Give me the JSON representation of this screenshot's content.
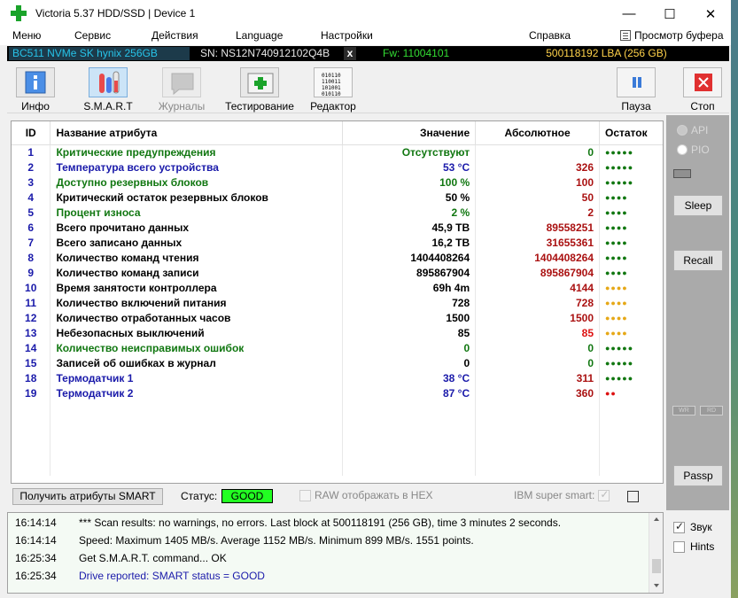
{
  "window": {
    "title": "Victoria 5.37 HDD/SSD | Device 1",
    "minimize": "—",
    "maximize": "☐",
    "close": "✕"
  },
  "menu": {
    "items": [
      "Меню",
      "Сервис",
      "Действия",
      "Language",
      "Настройки",
      "Справка"
    ],
    "buffer": "Просмотр буфера"
  },
  "drive": {
    "model": "BC511 NVMe SK hynix 256GB",
    "sn": "SN: NS12N740912102Q4B",
    "close": "x",
    "fw": "Fw: 11004101",
    "lba": "500118192 LBA (256 GB)"
  },
  "toolbar": {
    "info": "Инфо",
    "smart": "S.M.A.R.T",
    "logs": "Журналы",
    "test": "Тестирование",
    "editor": "Редактор",
    "pause": "Пауза",
    "stop": "Стоп"
  },
  "table": {
    "headers": {
      "id": "ID",
      "name": "Название атрибута",
      "value": "Значение",
      "abs": "Абсолютное",
      "rem": "Остаток"
    },
    "rows": [
      {
        "id": "1",
        "name": "Критические предупреждения",
        "value": "Отсутствуют",
        "abs": "0",
        "rem": "●●●●●",
        "name_color": "#117711",
        "value_color": "#117711",
        "abs_color": "#117711",
        "rem_color": "#117711"
      },
      {
        "id": "2",
        "name": "Температура всего устройства",
        "value": "53 °C",
        "abs": "326",
        "rem": "●●●●●",
        "name_color": "#1a1aaa",
        "value_color": "#1a1aaa",
        "abs_color": "#aa1111",
        "rem_color": "#117711"
      },
      {
        "id": "3",
        "name": "Доступно резервных блоков",
        "value": "100 %",
        "abs": "100",
        "rem": "●●●●●",
        "name_color": "#117711",
        "value_color": "#117711",
        "abs_color": "#aa1111",
        "rem_color": "#117711"
      },
      {
        "id": "4",
        "name": "Критический остаток резервных блоков",
        "value": "50 %",
        "abs": "50",
        "rem": "●●●●",
        "name_color": "#000000",
        "value_color": "#000000",
        "abs_color": "#aa1111",
        "rem_color": "#117711"
      },
      {
        "id": "5",
        "name": "Процент износа",
        "value": "2 %",
        "abs": "2",
        "rem": "●●●●",
        "name_color": "#117711",
        "value_color": "#117711",
        "abs_color": "#aa1111",
        "rem_color": "#117711"
      },
      {
        "id": "6",
        "name": "Всего прочитано данных",
        "value": "45,9 ТВ",
        "abs": "89558251",
        "rem": "●●●●",
        "name_color": "#000000",
        "value_color": "#000000",
        "abs_color": "#aa1111",
        "rem_color": "#117711"
      },
      {
        "id": "7",
        "name": "Всего записано данных",
        "value": "16,2 ТВ",
        "abs": "31655361",
        "rem": "●●●●",
        "name_color": "#000000",
        "value_color": "#000000",
        "abs_color": "#aa1111",
        "rem_color": "#117711"
      },
      {
        "id": "8",
        "name": "Количество команд чтения",
        "value": "1404408264",
        "abs": "1404408264",
        "rem": "●●●●",
        "name_color": "#000000",
        "value_color": "#000000",
        "abs_color": "#aa1111",
        "rem_color": "#117711"
      },
      {
        "id": "9",
        "name": "Количество команд записи",
        "value": "895867904",
        "abs": "895867904",
        "rem": "●●●●",
        "name_color": "#000000",
        "value_color": "#000000",
        "abs_color": "#aa1111",
        "rem_color": "#117711"
      },
      {
        "id": "10",
        "name": "Время занятости контроллера",
        "value": "69h 4m",
        "abs": "4144",
        "rem": "●●●●",
        "name_color": "#000000",
        "value_color": "#000000",
        "abs_color": "#aa1111",
        "rem_color": "#e6a817"
      },
      {
        "id": "11",
        "name": "Количество включений питания",
        "value": "728",
        "abs": "728",
        "rem": "●●●●",
        "name_color": "#000000",
        "value_color": "#000000",
        "abs_color": "#aa1111",
        "rem_color": "#e6a817"
      },
      {
        "id": "12",
        "name": "Количество отработанных часов",
        "value": "1500",
        "abs": "1500",
        "rem": "●●●●",
        "name_color": "#000000",
        "value_color": "#000000",
        "abs_color": "#aa1111",
        "rem_color": "#e6a817"
      },
      {
        "id": "13",
        "name": "Небезопасных выключений",
        "value": "85",
        "abs": "85",
        "rem": "●●●●",
        "name_color": "#000000",
        "value_color": "#000000",
        "abs_color": "#dd1111",
        "rem_color": "#e6a817"
      },
      {
        "id": "14",
        "name": "Количество неисправимых ошибок",
        "value": "0",
        "abs": "0",
        "rem": "●●●●●",
        "name_color": "#117711",
        "value_color": "#117711",
        "abs_color": "#117711",
        "rem_color": "#117711"
      },
      {
        "id": "15",
        "name": "Записей об ошибках в журнал",
        "value": "0",
        "abs": "0",
        "rem": "●●●●●",
        "name_color": "#000000",
        "value_color": "#000000",
        "abs_color": "#117711",
        "rem_color": "#117711"
      },
      {
        "id": "18",
        "name": "Термодатчик 1",
        "value": "38 °C",
        "abs": "311",
        "rem": "●●●●●",
        "name_color": "#1a1aaa",
        "value_color": "#1a1aaa",
        "abs_color": "#aa1111",
        "rem_color": "#117711"
      },
      {
        "id": "19",
        "name": "Термодатчик 2",
        "value": "87 °C",
        "abs": "360",
        "rem": "●●",
        "name_color": "#1a1aaa",
        "value_color": "#1a1aaa",
        "abs_color": "#aa1111",
        "rem_color": "#dd1111"
      }
    ]
  },
  "right_panel": {
    "api": "API",
    "pio": "PIO",
    "sleep": "Sleep",
    "recall": "Recall",
    "wr": "WR",
    "rd": "RD",
    "passp": "Passp"
  },
  "bottom": {
    "get_smart": "Получить атрибуты SMART",
    "status_label": "Статус:",
    "status_value": "GOOD",
    "raw_hex": "RAW отображать в HEX",
    "ibm": "IBM super smart:"
  },
  "log": [
    {
      "time": "16:14:14",
      "text": "*** Scan results: no warnings, no errors. Last block at 500118191 (256 GB), time 3 minutes 2 seconds.",
      "color": "#000000"
    },
    {
      "time": "16:14:14",
      "text": "Speed: Maximum 1405 MB/s. Average 1152 MB/s. Minimum 899 MB/s. 1551 points.",
      "color": "#000000"
    },
    {
      "time": "16:25:34",
      "text": "Get S.M.A.R.T. command... OK",
      "color": "#000000"
    },
    {
      "time": "16:25:34",
      "text": "Drive reported: SMART status = GOOD",
      "color": "#1a1aaa"
    }
  ],
  "log_side": {
    "sound": "Звук",
    "hints": "Hints"
  }
}
